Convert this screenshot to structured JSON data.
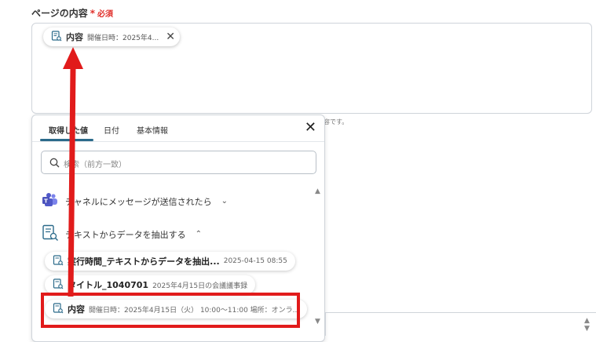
{
  "field": {
    "label": "ページの内容",
    "required_star": "*",
    "required_text": "必須",
    "hint": "容です。"
  },
  "selected_chip": {
    "title": "内容",
    "preview": "開催日時：2025年4..."
  },
  "panel": {
    "tabs": [
      {
        "label": "取得した値",
        "active": true
      },
      {
        "label": "日付",
        "active": false
      },
      {
        "label": "基本情報",
        "active": false
      }
    ],
    "search_placeholder": "検索（前方一致）",
    "groups": [
      {
        "label": "チャネルにメッセージが送信されたら"
      },
      {
        "label": "テキストからデータを抽出する"
      }
    ],
    "items": [
      {
        "title": "実行時間_テキストからデータを抽出...",
        "value": "2025-04-15 08:55"
      },
      {
        "title": "タイトル_1040701",
        "value": "2025年4月15日の会議議事録"
      },
      {
        "title": "内容",
        "value": "開催日時：2025年4月15日（火） 10:00〜11:00 場所：オンラ..."
      }
    ]
  },
  "colors": {
    "accent": "#2b6a8a",
    "annotation_red": "#e11b1b",
    "required_red": "#e0302b"
  }
}
